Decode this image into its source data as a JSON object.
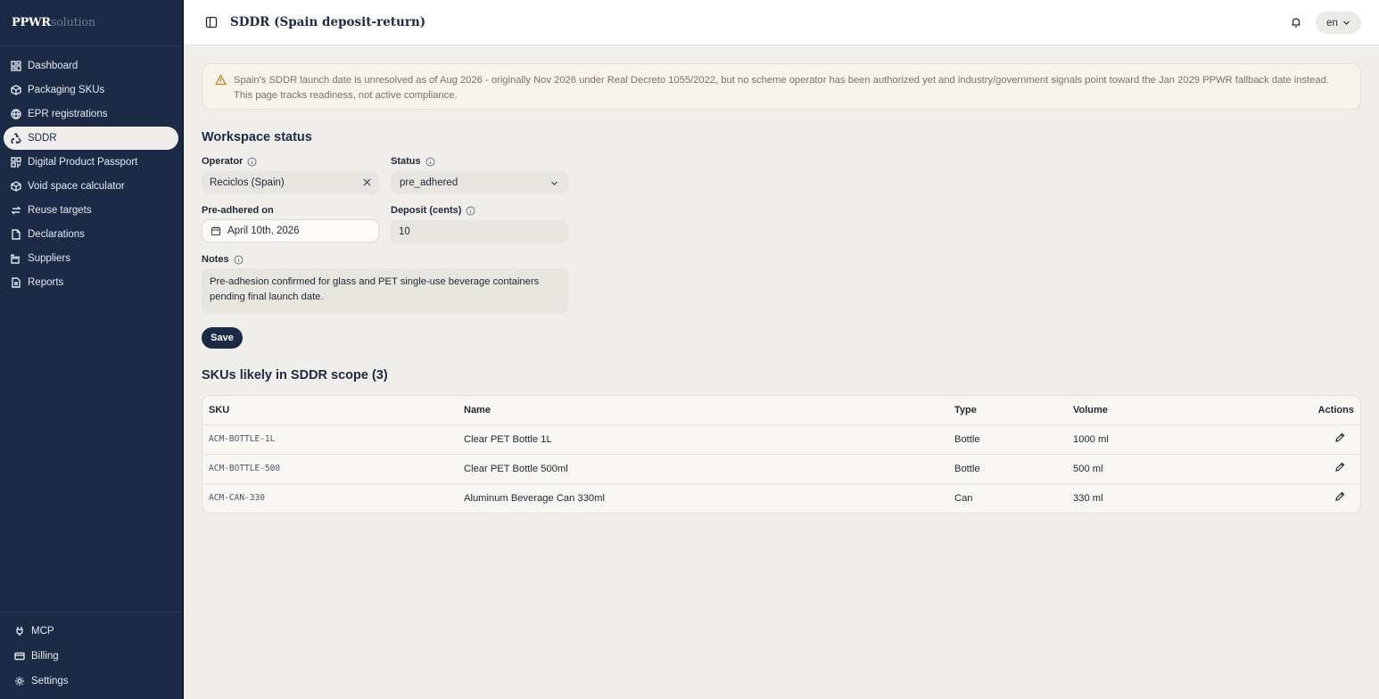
{
  "brand": {
    "part1": "PPWR",
    "part2": "solution"
  },
  "sidebar": {
    "items": [
      {
        "label": "Dashboard",
        "icon": "dashboard-icon"
      },
      {
        "label": "Packaging SKUs",
        "icon": "package-icon"
      },
      {
        "label": "EPR registrations",
        "icon": "globe-icon"
      },
      {
        "label": "SDDR",
        "icon": "recycle-icon",
        "active": true
      },
      {
        "label": "Digital Product Passport",
        "icon": "qr-code-icon"
      },
      {
        "label": "Void space calculator",
        "icon": "box-icon"
      },
      {
        "label": "Reuse targets",
        "icon": "repeat-icon"
      },
      {
        "label": "Declarations",
        "icon": "file-icon"
      },
      {
        "label": "Suppliers",
        "icon": "factory-icon"
      },
      {
        "label": "Reports",
        "icon": "report-icon"
      }
    ],
    "bottom": [
      {
        "label": "MCP",
        "icon": "plug-icon"
      },
      {
        "label": "Billing",
        "icon": "credit-card-icon"
      },
      {
        "label": "Settings",
        "icon": "gear-icon"
      }
    ]
  },
  "header": {
    "title": "SDDR (Spain deposit-return)",
    "language": "en"
  },
  "alert": {
    "text": "Spain's SDDR launch date is unresolved as of Aug 2026 - originally Nov 2026 under Real Decreto 1055/2022, but no scheme operator has been authorized yet and industry/government signals point toward the Jan 2029 PPWR fallback date instead. This page tracks readiness, not active compliance."
  },
  "workspace": {
    "title": "Workspace status",
    "operator_label": "Operator",
    "operator_value": "Reciclos (Spain)",
    "status_label": "Status",
    "status_value": "pre_adhered",
    "pre_adhered_label": "Pre-adhered on",
    "pre_adhered_value": "April 10th, 2026",
    "deposit_label": "Deposit (cents)",
    "deposit_value": "10",
    "notes_label": "Notes",
    "notes_value": "Pre-adhesion confirmed for glass and PET single-use beverage containers pending final launch date.",
    "save_label": "Save"
  },
  "skus": {
    "title": "SKUs likely in SDDR scope (3)",
    "columns": {
      "sku": "SKU",
      "name": "Name",
      "type": "Type",
      "volume": "Volume",
      "actions": "Actions"
    },
    "rows": [
      {
        "sku": "ACM-BOTTLE-1L",
        "name": "Clear PET Bottle 1L",
        "type": "Bottle",
        "volume": "1000 ml"
      },
      {
        "sku": "ACM-BOTTLE-500",
        "name": "Clear PET Bottle 500ml",
        "type": "Bottle",
        "volume": "500 ml"
      },
      {
        "sku": "ACM-CAN-330",
        "name": "Aluminum Beverage Can 330ml",
        "type": "Can",
        "volume": "330 ml"
      }
    ]
  }
}
